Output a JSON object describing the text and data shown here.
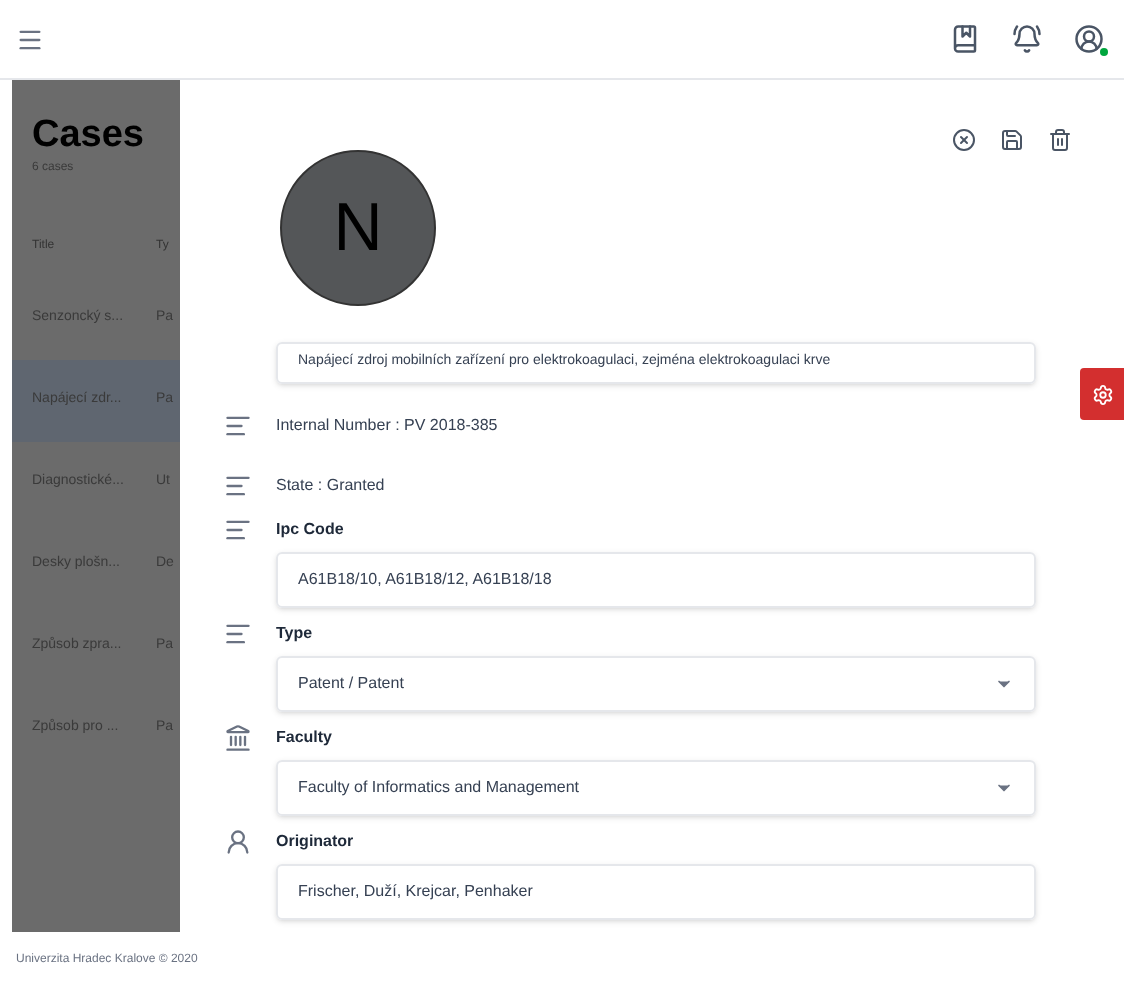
{
  "cases": {
    "title": "Cases",
    "count": "6 cases",
    "columns": [
      "Title",
      "Ty"
    ],
    "rows": [
      {
        "cells": [
          "Senzoncký s...",
          "Pa"
        ],
        "selected": false
      },
      {
        "cells": [
          "Napájecí zdr...",
          "Pa"
        ],
        "selected": true
      },
      {
        "cells": [
          "Diagnostické...",
          "Ut"
        ],
        "selected": false
      },
      {
        "cells": [
          "Desky plošn...",
          "De"
        ],
        "selected": false
      },
      {
        "cells": [
          "Způsob zpra...",
          "Pa"
        ],
        "selected": false
      },
      {
        "cells": [
          "Způsob pro ...",
          "Pa"
        ],
        "selected": false
      }
    ]
  },
  "detail": {
    "avatar": "N",
    "title_value": "Napájecí zdroj mobilních zařízení pro elektrokoagulaci, zejména elektrokoagulaci krve",
    "fields": [
      {
        "kind": "text",
        "text": "Internal Number : PV 2018-385"
      },
      {
        "kind": "text",
        "text": "State : Granted"
      },
      {
        "kind": "input",
        "label": "Ipc Code",
        "value": "A61B18/10, A61B18/12, A61B18/18"
      },
      {
        "kind": "select",
        "label": "Type",
        "value": "Patent / Patent"
      },
      {
        "kind": "select",
        "label": "Faculty",
        "value": "Faculty of Informatics and Management"
      },
      {
        "kind": "input",
        "label": "Originator",
        "value": "Frischer, Duží, Krejcar, Penhaker"
      }
    ]
  },
  "footer": "Univerzita Hradec Kralove © 2020"
}
